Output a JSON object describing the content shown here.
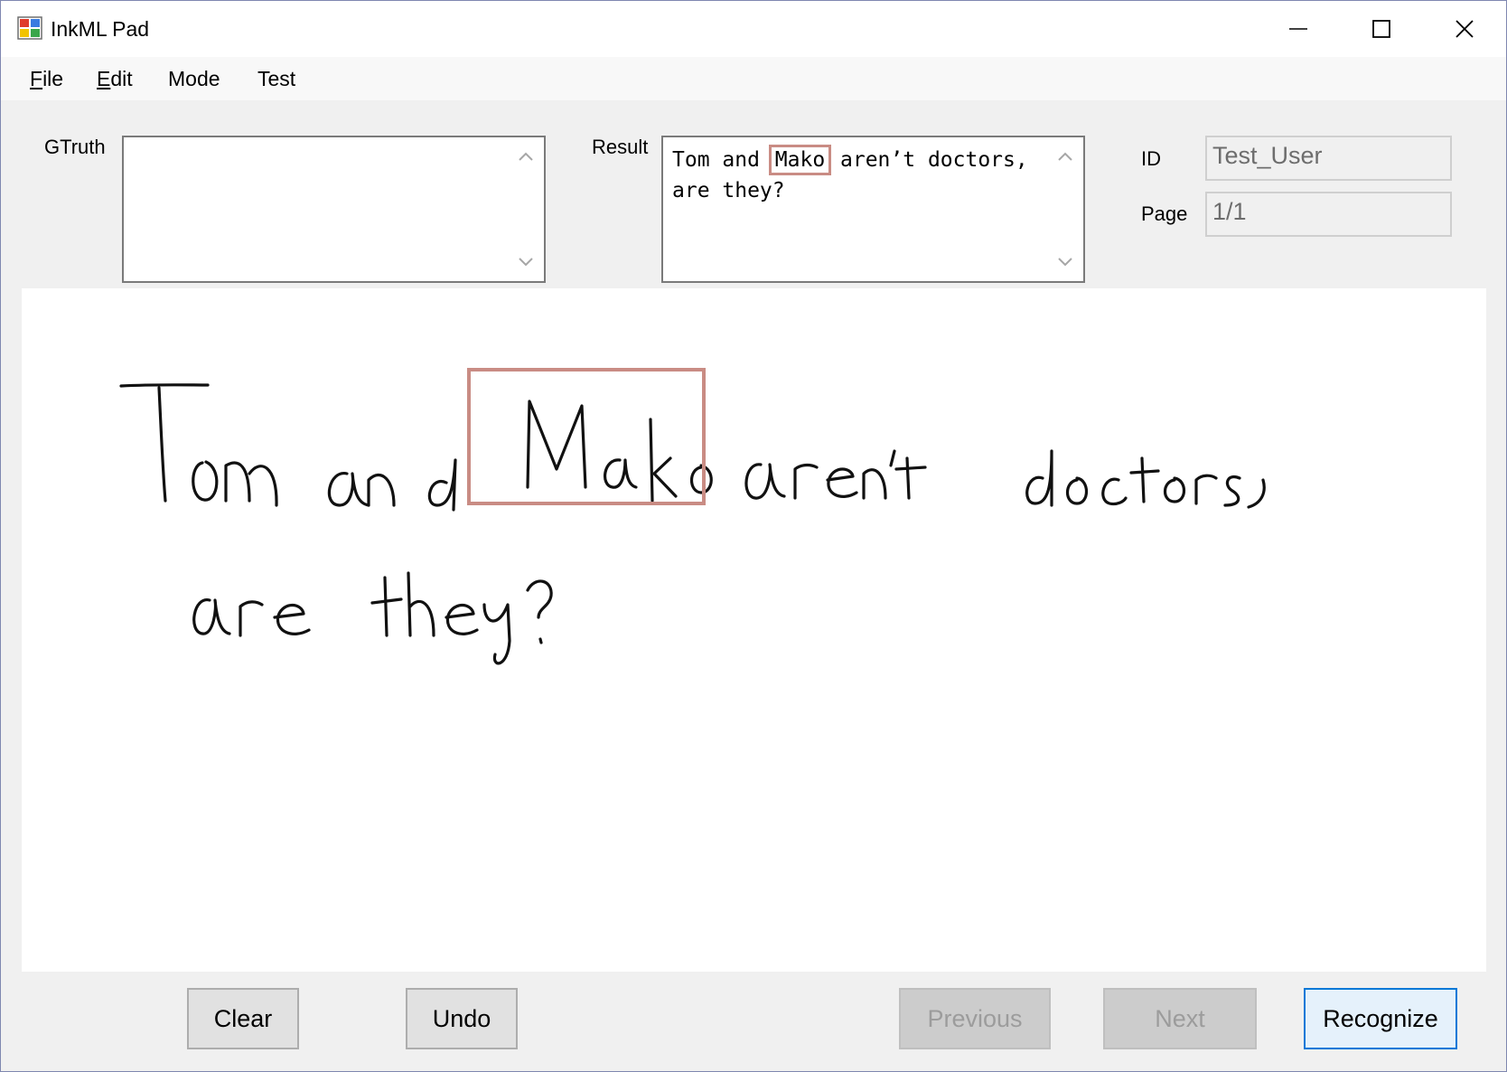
{
  "window": {
    "title": "InkML Pad"
  },
  "menu": {
    "items": [
      {
        "label": "File",
        "mnemonic": "F",
        "rest": "ile"
      },
      {
        "label": "Edit",
        "mnemonic": "E",
        "rest": "dit"
      },
      {
        "label": "Mode",
        "mnemonic": "",
        "rest": "Mode"
      },
      {
        "label": "Test",
        "mnemonic": "",
        "rest": "Test"
      }
    ]
  },
  "gtruth": {
    "label": "GTruth",
    "value": ""
  },
  "result": {
    "label": "Result",
    "text_before": "Tom and ",
    "highlight": "Mako",
    "text_after": " aren’t doctors,\nare they?"
  },
  "id_field": {
    "label": "ID",
    "value": "Test_User"
  },
  "page_field": {
    "label": "Page",
    "value": "1/1"
  },
  "buttons": {
    "clear": "Clear",
    "undo": "Undo",
    "previous": "Previous",
    "next": "Next",
    "recognize": "Recognize"
  },
  "colors": {
    "highlight_box": "#c98c84",
    "focus_border": "#0078d7",
    "window_border": "#7f87b0"
  },
  "icons": {
    "app": "inkml-app-icon",
    "minimize": "minimize-icon",
    "maximize": "maximize-icon",
    "close": "close-icon",
    "scroll_up": "chevron-up-icon",
    "scroll_down": "chevron-down-icon"
  }
}
